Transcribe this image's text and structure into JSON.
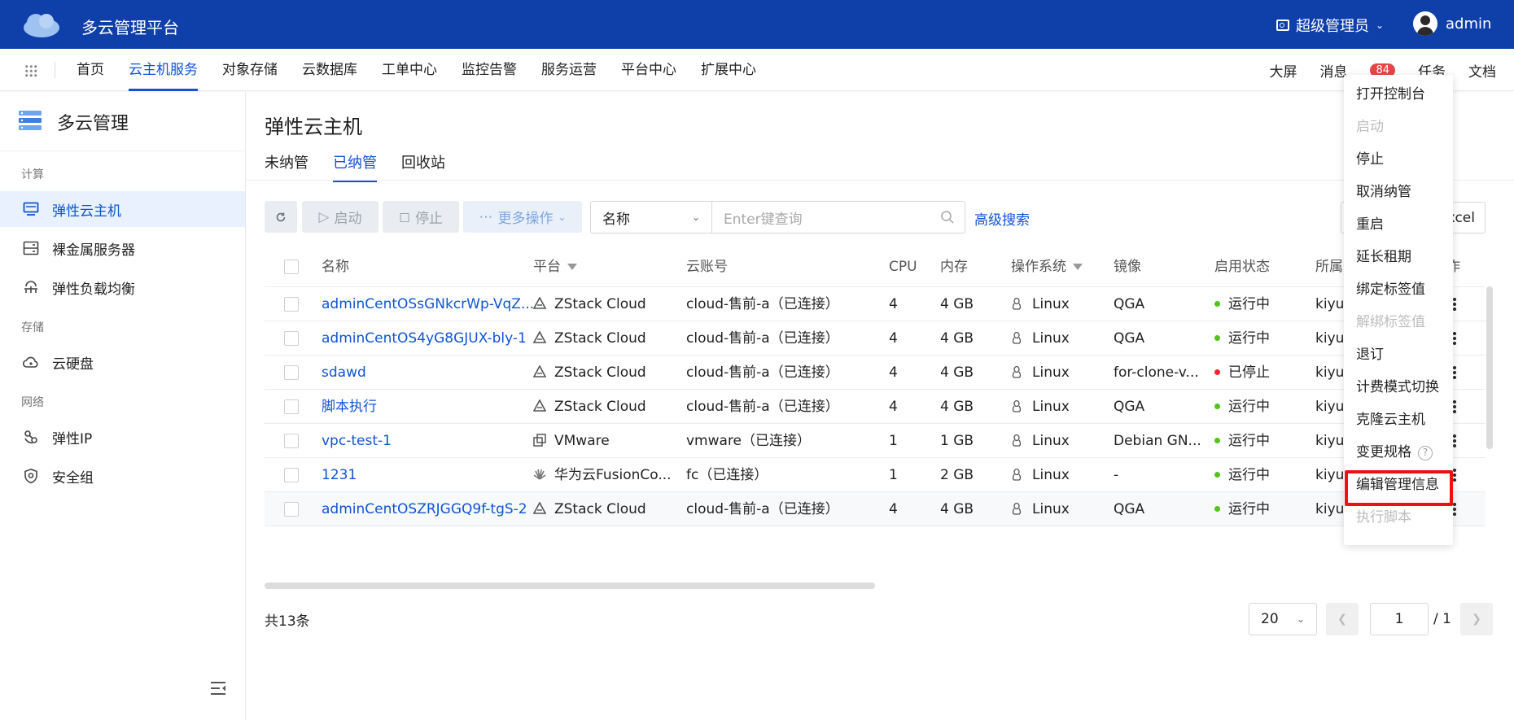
{
  "header": {
    "app_title": "多云管理平台",
    "role": "超级管理员",
    "username": "admin",
    "brand_color": "#0f3fa8"
  },
  "nav": {
    "items": [
      "首页",
      "云主机服务",
      "对象存储",
      "云数据库",
      "工单中心",
      "监控告警",
      "服务运营",
      "平台中心",
      "扩展中心"
    ],
    "active_index": 1,
    "right": {
      "screen": "大屏",
      "messages": "消息",
      "message_count": "84",
      "tasks": "任务",
      "docs": "文档"
    }
  },
  "sidebar": {
    "title": "多云管理",
    "sections": {
      "compute": "计算",
      "storage": "存储",
      "network": "网络"
    },
    "items": {
      "ecs": "弹性云主机",
      "bare_metal": "裸金属服务器",
      "lb": "弹性负载均衡",
      "disk": "云硬盘",
      "eip": "弹性IP",
      "security_group": "安全组"
    }
  },
  "main": {
    "title": "弹性云主机",
    "tabs": [
      "未纳管",
      "已纳管",
      "回收站"
    ],
    "active_tab": 1,
    "toolbar": {
      "start": "启动",
      "stop": "停止",
      "more": "更多操作",
      "search_field": "名称",
      "search_placeholder": "Enter键查询",
      "advanced": "高级搜索",
      "export": "xcel"
    },
    "columns": {
      "name": "名称",
      "platform": "平台",
      "account": "云账号",
      "cpu": "CPU",
      "memory": "内存",
      "os": "操作系统",
      "image": "镜像",
      "status": "启用状态",
      "owner": "所属",
      "action": "作"
    },
    "rows": [
      {
        "name": "adminCentOSsGNkcrWp-VqZ...",
        "platform": "ZStack Cloud",
        "account": "cloud-售前-a（已连接）",
        "cpu": "4",
        "memory": "4 GB",
        "os": "Linux",
        "image": "QGA",
        "status": "运行中",
        "status_color": "#52c41a",
        "owner": "kiyu-"
      },
      {
        "name": "adminCentOS4yG8GJUX-bly-1",
        "platform": "ZStack Cloud",
        "account": "cloud-售前-a（已连接）",
        "cpu": "4",
        "memory": "4 GB",
        "os": "Linux",
        "image": "QGA",
        "status": "运行中",
        "status_color": "#52c41a",
        "owner": "kiyu-"
      },
      {
        "name": "sdawd",
        "platform": "ZStack Cloud",
        "account": "cloud-售前-a（已连接）",
        "cpu": "4",
        "memory": "4 GB",
        "os": "Linux",
        "image": "for-clone-v...",
        "status": "已停止",
        "status_color": "#f5222d",
        "owner": "kiyu-"
      },
      {
        "name": "脚本执行",
        "platform": "ZStack Cloud",
        "account": "cloud-售前-a（已连接）",
        "cpu": "4",
        "memory": "4 GB",
        "os": "Linux",
        "image": "QGA",
        "status": "运行中",
        "status_color": "#52c41a",
        "owner": "kiyu-"
      },
      {
        "name": "vpc-test-1",
        "platform": "VMware",
        "account": "vmware（已连接）",
        "cpu": "1",
        "memory": "1 GB",
        "os": "Linux",
        "image": "Debian GN...",
        "status": "运行中",
        "status_color": "#52c41a",
        "owner": "kiyu"
      },
      {
        "name": "1231",
        "platform": "华为云FusionCo...",
        "account": "fc（已连接）",
        "cpu": "1",
        "memory": "2 GB",
        "os": "Linux",
        "image": "-",
        "status": "运行中",
        "status_color": "#52c41a",
        "owner": "kiyu-"
      },
      {
        "name": "adminCentOSZRJGGQ9f-tgS-2",
        "platform": "ZStack Cloud",
        "account": "cloud-售前-a（已连接）",
        "cpu": "4",
        "memory": "4 GB",
        "os": "Linux",
        "image": "QGA",
        "status": "运行中",
        "status_color": "#52c41a",
        "owner": "kiyu-vdc"
      }
    ],
    "footer": {
      "total": "共13条",
      "page_size": "20",
      "page": "1",
      "page_total": "/ 1"
    }
  },
  "context_menu": {
    "items": [
      {
        "label": "打开控制台",
        "disabled": false
      },
      {
        "label": "启动",
        "disabled": true
      },
      {
        "label": "停止",
        "disabled": false
      },
      {
        "label": "取消纳管",
        "disabled": false
      },
      {
        "label": "重启",
        "disabled": false
      },
      {
        "label": "延长租期",
        "disabled": false
      },
      {
        "label": "绑定标签值",
        "disabled": false
      },
      {
        "label": "解绑标签值",
        "disabled": true
      },
      {
        "label": "退订",
        "disabled": false
      },
      {
        "label": "计费模式切换",
        "disabled": false
      },
      {
        "label": "克隆云主机",
        "disabled": false
      },
      {
        "label": "变更规格",
        "disabled": false
      },
      {
        "label": "编辑管理信息",
        "disabled": false
      },
      {
        "label": "执行脚本",
        "disabled": true
      }
    ],
    "help_icon": "?",
    "highlight_color": "#ee1111"
  }
}
